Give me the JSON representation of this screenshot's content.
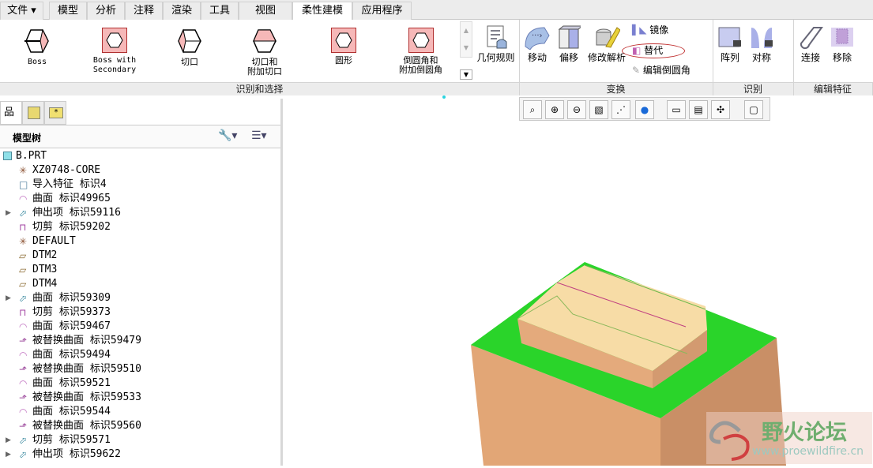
{
  "tabs": [
    {
      "label": "文件 ▾"
    },
    {
      "label": "模型"
    },
    {
      "label": "分析"
    },
    {
      "label": "注释"
    },
    {
      "label": "渲染"
    },
    {
      "label": "工具"
    },
    {
      "label": "视图"
    },
    {
      "label": "柔性建模",
      "active": true
    },
    {
      "label": "应用程序"
    }
  ],
  "ribbon": {
    "recognize_select": {
      "label": "识别和选择",
      "buttons": [
        "Boss",
        "Boss with Secondary",
        "切口",
        "切口和\n附加切口",
        "圆形",
        "倒圆角和\n附加倒圆角"
      ]
    },
    "geometry_rules": "几何规则",
    "transform": {
      "label": "变换",
      "buttons": [
        "移动",
        "偏移",
        "修改解析"
      ],
      "small": [
        "镜像",
        "替代",
        "编辑倒圆角"
      ]
    },
    "recognize": {
      "label": "识别",
      "buttons": [
        "阵列",
        "对称"
      ]
    },
    "edit_feature": {
      "label": "编辑特征",
      "buttons": [
        "连接",
        "移除"
      ]
    }
  },
  "view_toolbar": [
    "refit-icon",
    "zoom-in-icon",
    "zoom-out-icon",
    "repaint-icon",
    "datum-display-icon",
    "display-style-icon",
    "annotation-display-icon",
    "saved-views-icon",
    "spin-center-icon",
    "view-manager-icon"
  ],
  "model_tree": {
    "title": "模型树",
    "root": "B.PRT",
    "items": [
      {
        "label": "XZ0748-CORE",
        "icon": "csys",
        "exp": false
      },
      {
        "label": "导入特征 标识4",
        "icon": "import",
        "exp": false
      },
      {
        "label": "曲面 标识49965",
        "icon": "surface",
        "exp": false
      },
      {
        "label": "伸出项 标识59116",
        "icon": "extrude",
        "exp": true
      },
      {
        "label": "切剪 标识59202",
        "icon": "cut",
        "exp": false
      },
      {
        "label": "DEFAULT",
        "icon": "csys",
        "exp": false
      },
      {
        "label": "DTM2",
        "icon": "plane",
        "exp": false
      },
      {
        "label": "DTM3",
        "icon": "plane",
        "exp": false
      },
      {
        "label": "DTM4",
        "icon": "plane",
        "exp": false
      },
      {
        "label": "曲面 标识59309",
        "icon": "extrude",
        "exp": true
      },
      {
        "label": "切剪 标识59373",
        "icon": "cut",
        "exp": false
      },
      {
        "label": "曲面 标识59467",
        "icon": "surface",
        "exp": false
      },
      {
        "label": "被替换曲面 标识59479",
        "icon": "replace",
        "exp": false
      },
      {
        "label": "曲面 标识59494",
        "icon": "surface",
        "exp": false
      },
      {
        "label": "被替换曲面 标识59510",
        "icon": "replace",
        "exp": false
      },
      {
        "label": "曲面 标识59521",
        "icon": "surface",
        "exp": false
      },
      {
        "label": "被替换曲面 标识59533",
        "icon": "replace",
        "exp": false
      },
      {
        "label": "曲面 标识59544",
        "icon": "surface",
        "exp": false
      },
      {
        "label": "被替换曲面 标识59560",
        "icon": "replace",
        "exp": false
      },
      {
        "label": "切剪 标识59571",
        "icon": "extrude",
        "exp": true
      },
      {
        "label": "伸出项 标识59622",
        "icon": "extrude",
        "exp": true
      }
    ]
  },
  "watermark": {
    "title": "野火论坛",
    "url": "www.proewildfire.cn"
  },
  "colors": {
    "highlight": "#2ad42a",
    "part": "#e2a676",
    "face": "#f7dca6"
  }
}
